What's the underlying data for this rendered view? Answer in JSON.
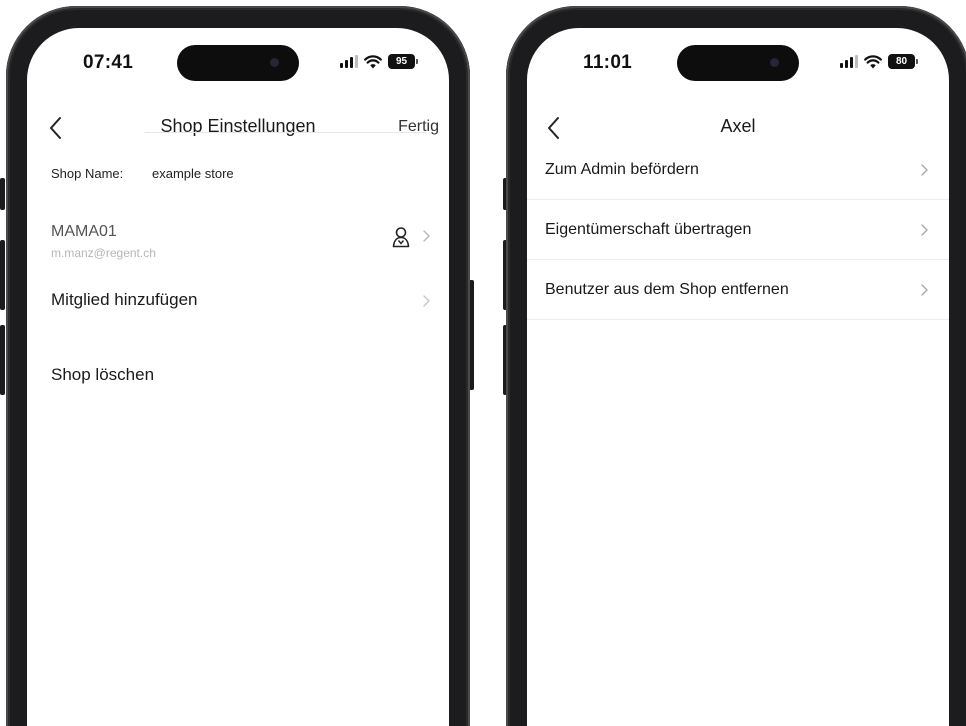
{
  "left_phone": {
    "status": {
      "time": "07:41",
      "battery": "95"
    },
    "nav": {
      "title": "Shop Einstellungen",
      "done_label": "Fertig"
    },
    "shop_name": {
      "label": "Shop Name:",
      "value": "example store"
    },
    "member": {
      "name": "MAMA01",
      "email": "m.manz@regent.ch"
    },
    "add_member_label": "Mitglied hinzufügen",
    "delete_shop_label": "Shop löschen"
  },
  "right_phone": {
    "status": {
      "time": "11:01",
      "battery": "80"
    },
    "nav": {
      "title": "Axel"
    },
    "actions": [
      {
        "label": "Zum Admin befördern"
      },
      {
        "label": "Eigentümerschaft übertragen"
      },
      {
        "label": "Benutzer aus dem Shop entfernen"
      }
    ]
  }
}
